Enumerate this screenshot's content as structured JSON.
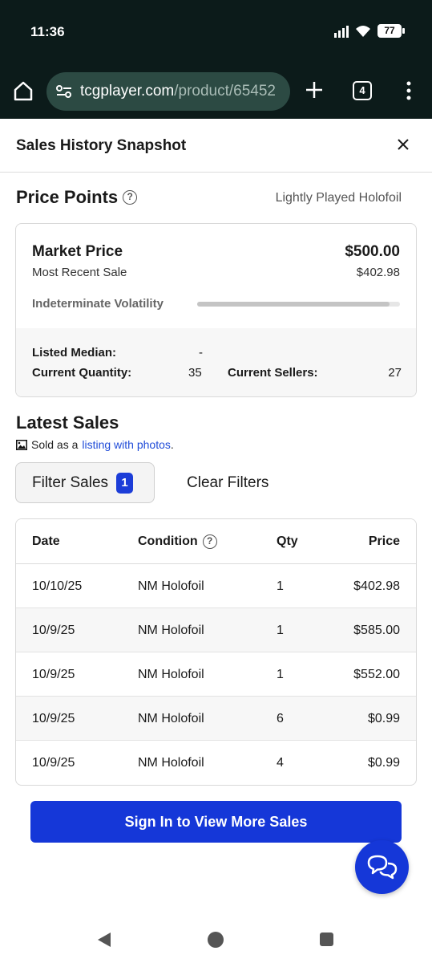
{
  "status_bar": {
    "time": "11:36",
    "battery": "77"
  },
  "browser": {
    "url_domain": "tcgplayer.com",
    "url_path": "/product/65452",
    "tab_count": "4"
  },
  "modal": {
    "title": "Sales History Snapshot"
  },
  "price_points": {
    "title": "Price Points",
    "condition": "Lightly Played Holofoil",
    "market_price_label": "Market Price",
    "market_price_value": "$500.00",
    "most_recent_label": "Most Recent Sale",
    "most_recent_value": "$402.98",
    "volatility_label": "Indeterminate Volatility",
    "volatility_level": 0.95,
    "listed_median_label": "Listed Median:",
    "listed_median_value": "-",
    "current_quantity_label": "Current Quantity:",
    "current_quantity_value": "35",
    "current_sellers_label": "Current Sellers:",
    "current_sellers_value": "27"
  },
  "latest_sales": {
    "title": "Latest Sales",
    "note_prefix": "Sold as a",
    "note_link": "listing with photos",
    "note_suffix": ".",
    "filter_label": "Filter Sales",
    "filter_count": "1",
    "clear_label": "Clear Filters",
    "columns": {
      "date": "Date",
      "condition": "Condition",
      "qty": "Qty",
      "price": "Price"
    },
    "rows": [
      {
        "date": "10/10/25",
        "condition": "NM Holofoil",
        "qty": "1",
        "price": "$402.98"
      },
      {
        "date": "10/9/25",
        "condition": "NM Holofoil",
        "qty": "1",
        "price": "$585.00"
      },
      {
        "date": "10/9/25",
        "condition": "NM Holofoil",
        "qty": "1",
        "price": "$552.00"
      },
      {
        "date": "10/9/25",
        "condition": "NM Holofoil",
        "qty": "6",
        "price": "$0.99"
      },
      {
        "date": "10/9/25",
        "condition": "NM Holofoil",
        "qty": "4",
        "price": "$0.99"
      }
    ]
  },
  "signin_label": "Sign In to View More Sales",
  "colors": {
    "brand_blue": "#1537d8",
    "browser_bg": "#0c1b1a",
    "url_bg": "#2c4a43"
  }
}
